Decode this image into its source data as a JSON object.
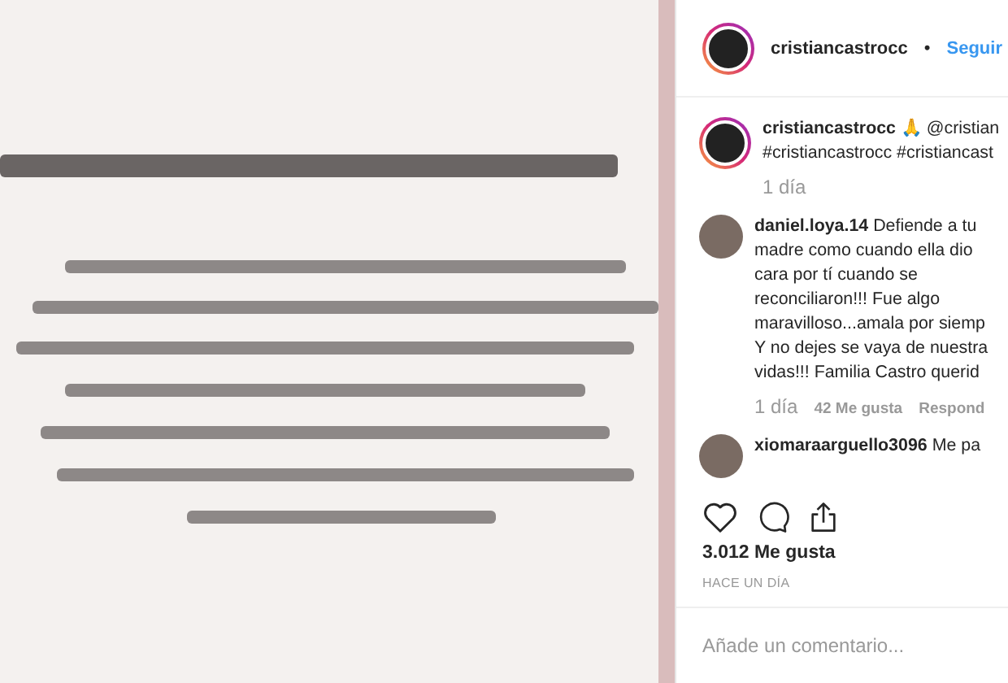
{
  "header": {
    "username": "cristiancastrocc",
    "separator": "•",
    "follow": "Seguir"
  },
  "comments": [
    {
      "kind": "caption",
      "text": "**cristiancastrocc** 🙏 @cristian\n#cristiancastrocc #cristiancast",
      "time": "1 día"
    },
    {
      "kind": "comment",
      "text": "**daniel.loya.14** Defiende a tu\nmadre como cuando ella dio\ncara por tí cuando se\nreconciliaron!!! Fue algo\nmaravilloso...amala por siemp\nY no dejes se vaya de nuestra\nvidas!!! Familia Castro querid",
      "time": "1 día",
      "likes": "42 Me gusta",
      "reply": "Respond"
    },
    {
      "kind": "comment",
      "text": "**xiomaraarguello3096** Me pa"
    }
  ],
  "likes": "3.012 Me gusta",
  "posted": "HACE UN DÍA",
  "comment_field": {
    "placeholder": "Añade un comentario..."
  }
}
